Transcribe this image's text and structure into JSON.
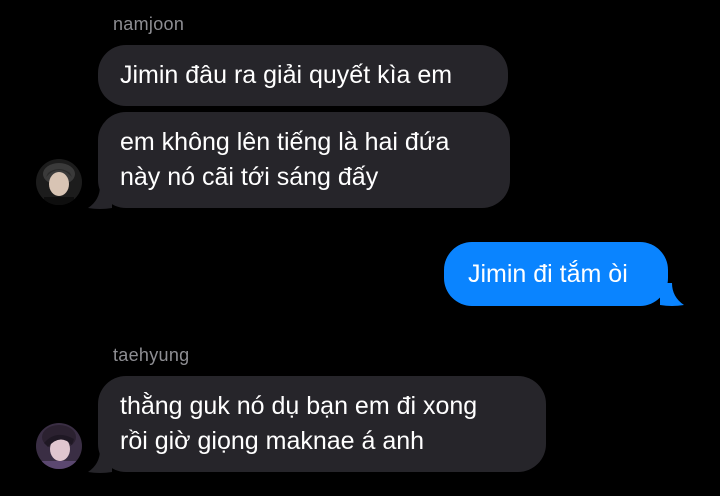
{
  "colors": {
    "background": "#000000",
    "incoming_bubble": "#26252a",
    "outgoing_bubble": "#0a84ff",
    "sender_name": "#8e8e93",
    "text": "#ffffff"
  },
  "groups": [
    {
      "sender": "namjoon",
      "avatar_icon": "profile-photo-avatar",
      "messages": [
        "Jimin đâu ra giải quyết kìa em",
        "em không lên tiếng là hai đứa\nnày nó cãi tới sáng đấy"
      ]
    },
    {
      "sender": "",
      "messages": [
        "Jimin đi tắm òi"
      ]
    },
    {
      "sender": "taehyung",
      "avatar_icon": "profile-photo-avatar",
      "messages": [
        "thằng guk nó dụ bạn em đi xong\nrồi giờ giọng maknae á anh"
      ]
    }
  ]
}
